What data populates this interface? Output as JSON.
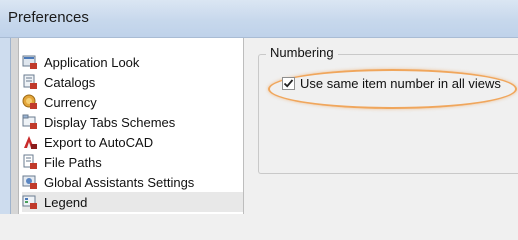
{
  "window": {
    "title": "Preferences"
  },
  "sidebar": {
    "items": [
      {
        "label": "Application Look",
        "icon": "application-look-icon"
      },
      {
        "label": "Catalogs",
        "icon": "catalogs-icon"
      },
      {
        "label": "Currency",
        "icon": "currency-icon"
      },
      {
        "label": "Display Tabs Schemes",
        "icon": "display-tabs-icon"
      },
      {
        "label": "Export to AutoCAD",
        "icon": "export-autocad-icon"
      },
      {
        "label": "File Paths",
        "icon": "file-paths-icon"
      },
      {
        "label": "Global Assistants Settings",
        "icon": "global-assistants-icon"
      },
      {
        "label": "Legend",
        "icon": "legend-icon",
        "selected": true
      }
    ]
  },
  "numbering": {
    "group_label": "Numbering",
    "checkbox_label": "Use same item number in all views",
    "checked": true
  },
  "colors": {
    "highlight": "#f0a65c"
  }
}
